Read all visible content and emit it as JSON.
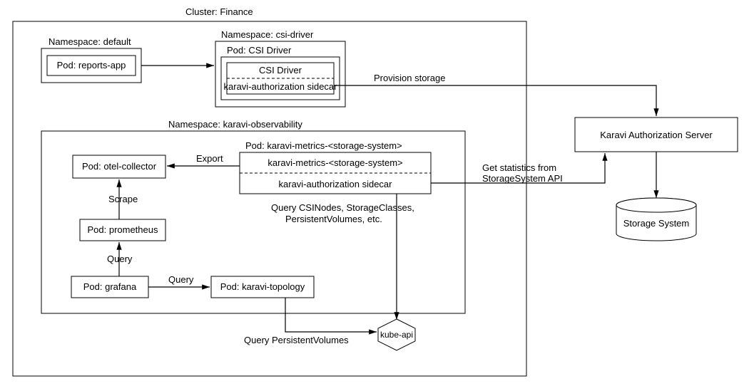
{
  "cluster": {
    "title": "Cluster: Finance"
  },
  "ns_default": {
    "title": "Namespace: default",
    "pod_reports": "Pod: reports-app"
  },
  "ns_csi": {
    "title": "Namespace: csi-driver",
    "pod_title": "Pod: CSI Driver",
    "csi_driver": "CSI Driver",
    "sidecar": "karavi-authorization sidecar"
  },
  "ns_obs": {
    "title": "Namespace: karavi-observability",
    "otel": "Pod: otel-collector",
    "prometheus": "Pod: prometheus",
    "grafana": "Pod: grafana",
    "topology": "Pod: karavi-topology",
    "metrics_pod_title": "Pod: karavi-metrics-<storage-system>",
    "metrics_top": "karavi-metrics-<storage-system>",
    "metrics_sidecar": "karavi-authorization sidecar"
  },
  "edges": {
    "export": "Export",
    "scrape": "Scrape",
    "query1": "Query",
    "query2": "Query",
    "query_csinodes_l1": "Query CSINodes, StorageClasses,",
    "query_csinodes_l2": "PersistentVolumes, etc.",
    "query_pv": "Query PersistentVolumes",
    "provision": "Provision storage",
    "get_stats_l1": "Get statistics from",
    "get_stats_l2": "StorageSystem API"
  },
  "kube_api": "kube-api",
  "auth_server": "Karavi Authorization Server",
  "storage_system": "Storage System"
}
